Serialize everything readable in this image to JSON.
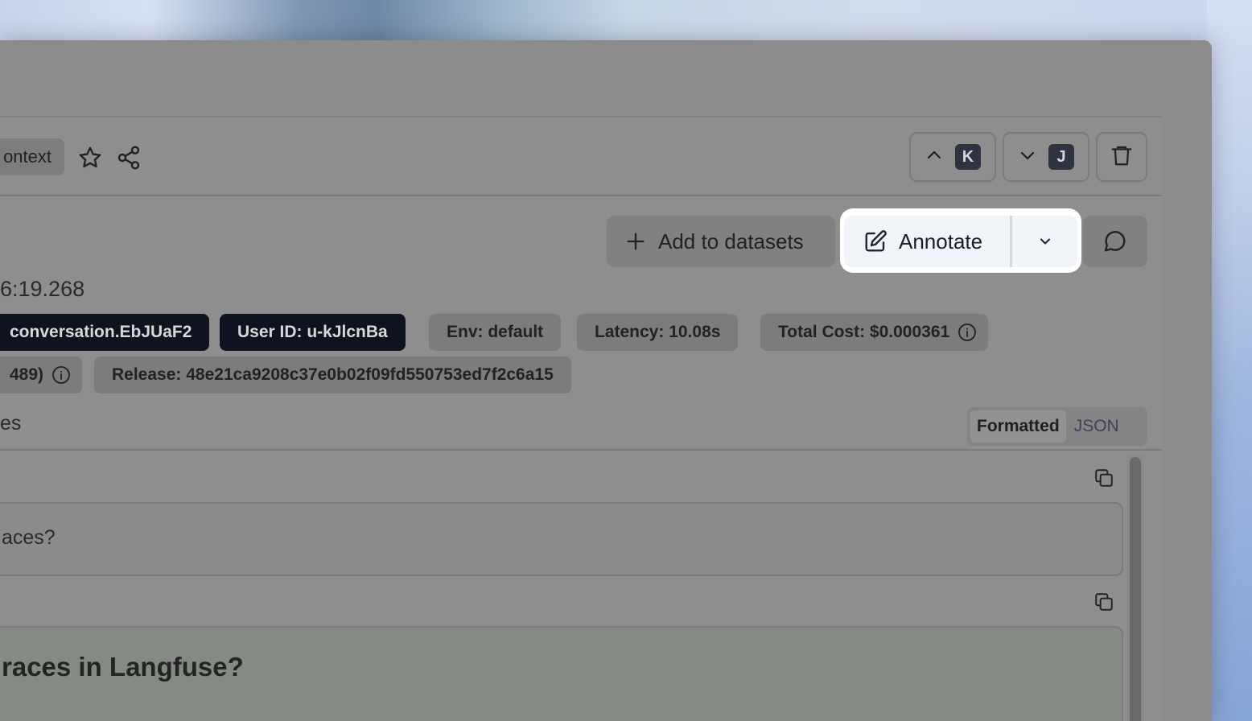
{
  "header": {
    "context_label": "ontext",
    "prev_key": "K",
    "next_key": "J"
  },
  "toolbar": {
    "add_to_datasets": "Add to datasets",
    "annotate": "Annotate"
  },
  "trace": {
    "timestamp": "6:19.268",
    "tags_row1": [
      {
        "text": "conversation.EbJUaF2",
        "style": "dark"
      },
      {
        "text": "User ID: u-kJlcnBa",
        "style": "dark"
      },
      {
        "text": "Env: default",
        "style": "light"
      },
      {
        "text": "Latency: 10.08s",
        "style": "light"
      },
      {
        "text": "Total Cost: $0.000361",
        "style": "light"
      }
    ],
    "tags_row2": [
      {
        "text": "489)",
        "style": "light"
      },
      {
        "text": "Release: 48e21ca9208c37e0b02f09fd550753ed7f2c6a15",
        "style": "light"
      }
    ]
  },
  "io": {
    "section_label": "es",
    "view_modes": [
      "Formatted",
      "JSON"
    ],
    "selected_view": "Formatted",
    "input_text": "aces?",
    "output_text": "races in Langfuse?"
  },
  "colors": {
    "window_overlay": "#8c8c8c",
    "highlight": "#ffffff",
    "dark_tag": "#0f1320",
    "output_bg": "#858a85"
  }
}
